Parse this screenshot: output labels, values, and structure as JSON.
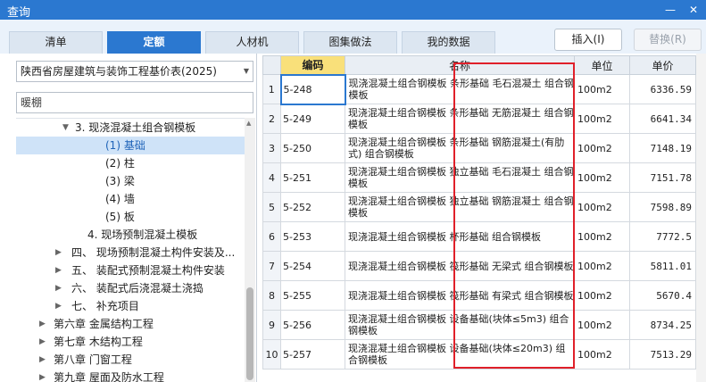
{
  "window": {
    "title": "查询",
    "min_glyph": "—",
    "close_glyph": "✕"
  },
  "tabs": [
    "清单",
    "定额",
    "人材机",
    "图集做法",
    "我的数据"
  ],
  "active_tab": "定额",
  "buttons": {
    "insert": "插入(I)",
    "replace": "替换(R)"
  },
  "left": {
    "library": "陕西省房屋建筑与装饰工程基价表(2025)",
    "search_value": "暖棚",
    "tree": [
      {
        "label": "3. 现浇混凝土组合钢模板",
        "arrow": "▼",
        "selected": false
      },
      {
        "label": "(1) 基础",
        "arrow": "",
        "selected": true
      },
      {
        "label": "(2) 柱",
        "arrow": "",
        "selected": false
      },
      {
        "label": "(3) 梁",
        "arrow": "",
        "selected": false
      },
      {
        "label": "(4) 墙",
        "arrow": "",
        "selected": false
      },
      {
        "label": "(5) 板",
        "arrow": "",
        "selected": false
      },
      {
        "label": "4. 现场预制混凝土模板",
        "arrow": "",
        "selected": false
      },
      {
        "label": "四、 现场预制混凝土构件安装及...",
        "arrow": "▶",
        "selected": false
      },
      {
        "label": "五、 装配式预制混凝土构件安装",
        "arrow": "▶",
        "selected": false
      },
      {
        "label": "六、 装配式后浇混凝土浇捣",
        "arrow": "▶",
        "selected": false
      },
      {
        "label": "七、 补充项目",
        "arrow": "▶",
        "selected": false
      },
      {
        "label": "第六章 金属结构工程",
        "arrow": "▶",
        "selected": false
      },
      {
        "label": "第七章 木结构工程",
        "arrow": "▶",
        "selected": false
      },
      {
        "label": "第八章 门窗工程",
        "arrow": "▶",
        "selected": false
      },
      {
        "label": "第九章 屋面及防水工程",
        "arrow": "▶",
        "selected": false
      }
    ]
  },
  "grid": {
    "headers": {
      "index": "",
      "code": "编码",
      "name": "名称",
      "unit": "单位",
      "price": "单价"
    },
    "rows": [
      {
        "no": "1",
        "code": "5-248",
        "name": "现浇混凝土组合钢模板 条形基础 毛石混凝土 组合钢模板",
        "unit": "100m2",
        "price": "6336.59"
      },
      {
        "no": "2",
        "code": "5-249",
        "name": "现浇混凝土组合钢模板 条形基础 无筋混凝土 组合钢模板",
        "unit": "100m2",
        "price": "6641.34"
      },
      {
        "no": "3",
        "code": "5-250",
        "name": "现浇混凝土组合钢模板 条形基础 钢筋混凝土(有肋式) 组合钢模板",
        "unit": "100m2",
        "price": "7148.19"
      },
      {
        "no": "4",
        "code": "5-251",
        "name": "现浇混凝土组合钢模板 独立基础 毛石混凝土 组合钢模板",
        "unit": "100m2",
        "price": "7151.78"
      },
      {
        "no": "5",
        "code": "5-252",
        "name": "现浇混凝土组合钢模板 独立基础 钢筋混凝土 组合钢模板",
        "unit": "100m2",
        "price": "7598.89"
      },
      {
        "no": "6",
        "code": "5-253",
        "name": "现浇混凝土组合钢模板 杯形基础 组合钢模板",
        "unit": "100m2",
        "price": "7772.5"
      },
      {
        "no": "7",
        "code": "5-254",
        "name": "现浇混凝土组合钢模板 筏形基础 无梁式 组合钢模板",
        "unit": "100m2",
        "price": "5811.01"
      },
      {
        "no": "8",
        "code": "5-255",
        "name": "现浇混凝土组合钢模板 筏形基础 有梁式 组合钢模板",
        "unit": "100m2",
        "price": "5670.4"
      },
      {
        "no": "9",
        "code": "5-256",
        "name": "现浇混凝土组合钢模板 设备基础(块体≤5m3) 组合钢模板",
        "unit": "100m2",
        "price": "8734.25"
      },
      {
        "no": "10",
        "code": "5-257",
        "name": "现浇混凝土组合钢模板 设备基础(块体≤20m3) 组合钢模板",
        "unit": "100m2",
        "price": "7513.29"
      }
    ]
  },
  "colors": {
    "accent": "#2b78d0",
    "highlight_box": "#e0202a",
    "code_header": "#f9e07a"
  }
}
